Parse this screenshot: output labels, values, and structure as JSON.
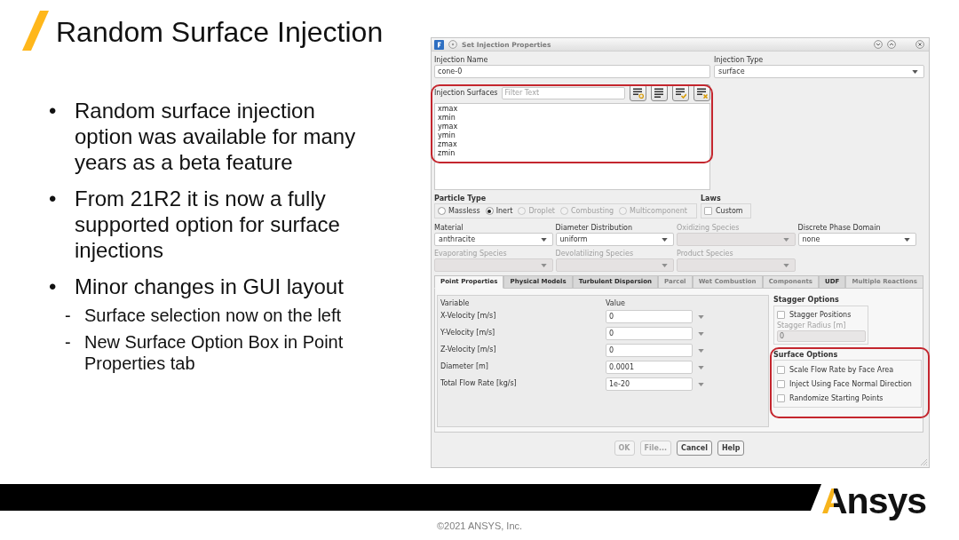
{
  "slide": {
    "title": "Random Surface Injection",
    "bullets": [
      {
        "marker": "•",
        "text": "Random surface injection option was available for many years as a beta feature"
      },
      {
        "marker": "•",
        "text": "From 21R2 it is now a fully supported option for surface injections"
      },
      {
        "marker": "•",
        "text": "Minor changes in GUI layout",
        "children": [
          {
            "marker": "-",
            "text": "Surface selection now on the left"
          },
          {
            "marker": "-",
            "text": "New Surface Option Box in Point Properties tab"
          }
        ]
      }
    ]
  },
  "dialog": {
    "title": "Set Injection Properties",
    "injection_name": {
      "label": "Injection Name",
      "value": "cone-0"
    },
    "injection_type": {
      "label": "Injection Type",
      "value": "surface"
    },
    "injection_surfaces": {
      "label": "Injection Surfaces",
      "placeholder": "Filter Text",
      "highlighted": true,
      "items": [
        {
          "label": "xmax",
          "selected": false
        },
        {
          "label": "xmin",
          "selected": false
        },
        {
          "label": "ymax",
          "selected": false
        },
        {
          "label": "ymin",
          "selected": false
        },
        {
          "label": "zmax",
          "selected": false
        },
        {
          "label": "zmin",
          "selected": false
        }
      ]
    },
    "particle_type": {
      "label": "Particle Type",
      "options": [
        {
          "label": "Massless",
          "selected": false,
          "disabled": false
        },
        {
          "label": "Inert",
          "selected": true,
          "disabled": false
        },
        {
          "label": "Droplet",
          "selected": false,
          "disabled": true
        },
        {
          "label": "Combusting",
          "selected": false,
          "disabled": true
        },
        {
          "label": "Multicomponent",
          "selected": false,
          "disabled": true
        }
      ]
    },
    "laws": {
      "label": "Laws",
      "options": [
        {
          "label": "Custom",
          "checked": false
        }
      ]
    },
    "dropdowns": [
      {
        "label": "Material",
        "value": "anthracite",
        "disabled": false
      },
      {
        "label": "Diameter Distribution",
        "value": "uniform",
        "disabled": false
      },
      {
        "label": "Oxidizing Species",
        "disabled": true
      },
      {
        "label": "Discrete Phase Domain",
        "value": "none",
        "disabled": false
      },
      {
        "label": "Evaporating Species",
        "disabled": true
      },
      {
        "label": "Devolatilizing Species",
        "disabled": true
      },
      {
        "label": "Product Species",
        "disabled": true
      }
    ],
    "tabs": [
      {
        "label": "Point Properties",
        "selected": true,
        "disabled": false
      },
      {
        "label": "Physical Models",
        "selected": false,
        "disabled": false
      },
      {
        "label": "Turbulent Dispersion",
        "selected": false,
        "disabled": false
      },
      {
        "label": "Parcel",
        "selected": false,
        "disabled": true
      },
      {
        "label": "Wet Combustion",
        "selected": false,
        "disabled": true
      },
      {
        "label": "Components",
        "selected": false,
        "disabled": true
      },
      {
        "label": "UDF",
        "selected": false,
        "disabled": false
      },
      {
        "label": "Multiple Reactions",
        "selected": false,
        "disabled": true
      }
    ],
    "point_properties": {
      "columns": [
        "Variable",
        "Value"
      ],
      "rows": [
        {
          "variable": "X-Velocity [m/s]",
          "value": "0"
        },
        {
          "variable": "Y-Velocity [m/s]",
          "value": "0"
        },
        {
          "variable": "Z-Velocity [m/s]",
          "value": "0"
        },
        {
          "variable": "Diameter [m]",
          "value": "0.0001"
        },
        {
          "variable": "Total Flow Rate [kg/s]",
          "value": "1e-20"
        }
      ]
    },
    "stagger_options": {
      "title": "Stagger Options",
      "options": [
        {
          "label": "Stagger Positions",
          "checked": false
        }
      ],
      "radius": {
        "label": "Stagger Radius [m]",
        "value": "0",
        "disabled": true
      }
    },
    "surface_options": {
      "title": "Surface Options",
      "highlighted": true,
      "options": [
        {
          "label": "Scale Flow Rate by Face Area",
          "checked": false
        },
        {
          "label": "Inject Using Face Normal Direction",
          "checked": false
        },
        {
          "label": "Randomize Starting Points",
          "checked": false
        }
      ]
    },
    "buttons": [
      {
        "label": "OK",
        "disabled": true
      },
      {
        "label": "File...",
        "disabled": true
      },
      {
        "label": "Cancel",
        "disabled": false
      },
      {
        "label": "Help",
        "disabled": false
      }
    ]
  },
  "footer": {
    "logo": "Ansys",
    "copyright": "©2021 ANSYS, Inc."
  }
}
